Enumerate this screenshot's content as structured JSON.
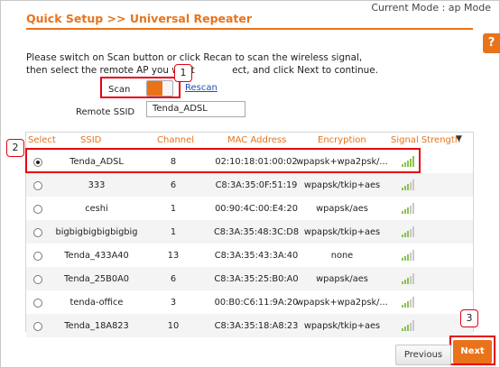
{
  "header": {
    "title": "Quick Setup >>  Universal Repeater",
    "mode": "Current Mode : ap Mode",
    "help_label": "?"
  },
  "instructions": {
    "line1": "Please switch on Scan button or click Recan to scan the wireless signal,",
    "line2": "then select the remote AP you want ",
    "line2_tail": "ect, and click Next to continue."
  },
  "scan": {
    "label": "Scan",
    "state": "on",
    "rescan_label": "Rescan"
  },
  "remote_ssid": {
    "label": "Remote SSID",
    "value": "Tenda_ADSL"
  },
  "table": {
    "headers": [
      "Select",
      "SSID",
      "Channel",
      "MAC Address",
      "Encryption",
      "Signal Strength"
    ],
    "sort_indicator": "▼",
    "rows": [
      {
        "selected": true,
        "ssid": "Tenda_ADSL",
        "channel": "8",
        "mac": "02:10:18:01:00:02",
        "encryption": "wpapsk+wpa2psk/...",
        "signal": 4
      },
      {
        "selected": false,
        "ssid": "333",
        "channel": "6",
        "mac": "C8:3A:35:0F:51:19",
        "encryption": "wpapsk/tkip+aes",
        "signal": 2
      },
      {
        "selected": false,
        "ssid": "ceshi",
        "channel": "1",
        "mac": "00:90:4C:00:E4:20",
        "encryption": "wpapsk/aes",
        "signal": 2
      },
      {
        "selected": false,
        "ssid": "bigbigbigbigbigbig",
        "channel": "1",
        "mac": "C8:3A:35:48:3C:D8",
        "encryption": "wpapsk/tkip+aes",
        "signal": 2
      },
      {
        "selected": false,
        "ssid": "Tenda_433A40",
        "channel": "13",
        "mac": "C8:3A:35:43:3A:40",
        "encryption": "none",
        "signal": 2
      },
      {
        "selected": false,
        "ssid": "Tenda_25B0A0",
        "channel": "6",
        "mac": "C8:3A:35:25:B0:A0",
        "encryption": "wpapsk/aes",
        "signal": 2
      },
      {
        "selected": false,
        "ssid": "tenda-office",
        "channel": "3",
        "mac": "00:B0:C6:11:9A:20",
        "encryption": "wpapsk+wpa2psk/...",
        "signal": 2
      },
      {
        "selected": false,
        "ssid": "Tenda_18A823",
        "channel": "10",
        "mac": "C8:3A:35:18:A8:23",
        "encryption": "wpapsk/tkip+aes",
        "signal": 2
      }
    ]
  },
  "buttons": {
    "previous": "Previous",
    "next": "Next"
  },
  "callouts": {
    "step1": "1",
    "step2": "2",
    "step3": "3"
  },
  "colors": {
    "accent": "#e8731a",
    "callout": "#e60012",
    "link": "#1a52b8",
    "signal": "#8ac44b"
  }
}
